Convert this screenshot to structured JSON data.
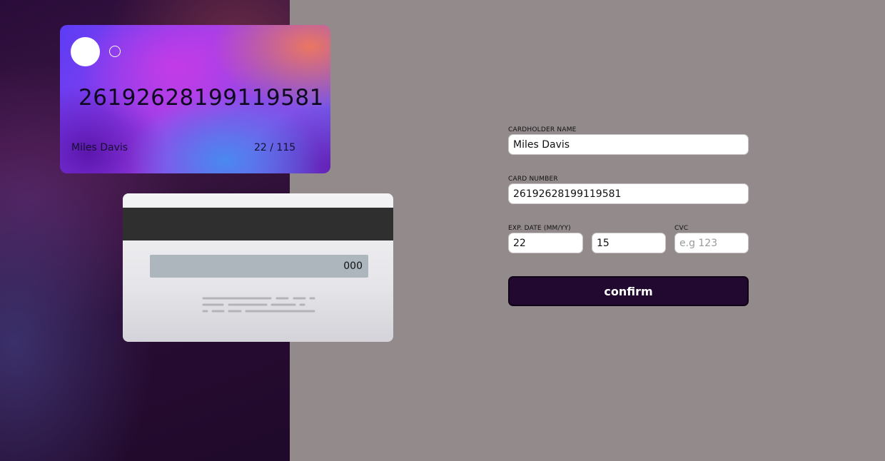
{
  "card_front": {
    "number": "26192628199119581",
    "name": "Miles Davis",
    "expiry": "22 / 115"
  },
  "card_back": {
    "cvc": "000"
  },
  "form": {
    "cardholder_name": {
      "label": "CARDHOLDER NAME",
      "value": "Miles Davis"
    },
    "card_number": {
      "label": "CARD NUMBER",
      "value": "26192628199119581"
    },
    "exp_date": {
      "label": "EXP. DATE (MM/YY)",
      "month": "22",
      "year": "15"
    },
    "cvc": {
      "label": "CVC",
      "value": "",
      "placeholder": "e.g 123"
    },
    "confirm_label": "confirm"
  },
  "colors": {
    "form_background": "#938a8c",
    "button": "#21092f",
    "card_back_strip": "#2f2f2f"
  }
}
